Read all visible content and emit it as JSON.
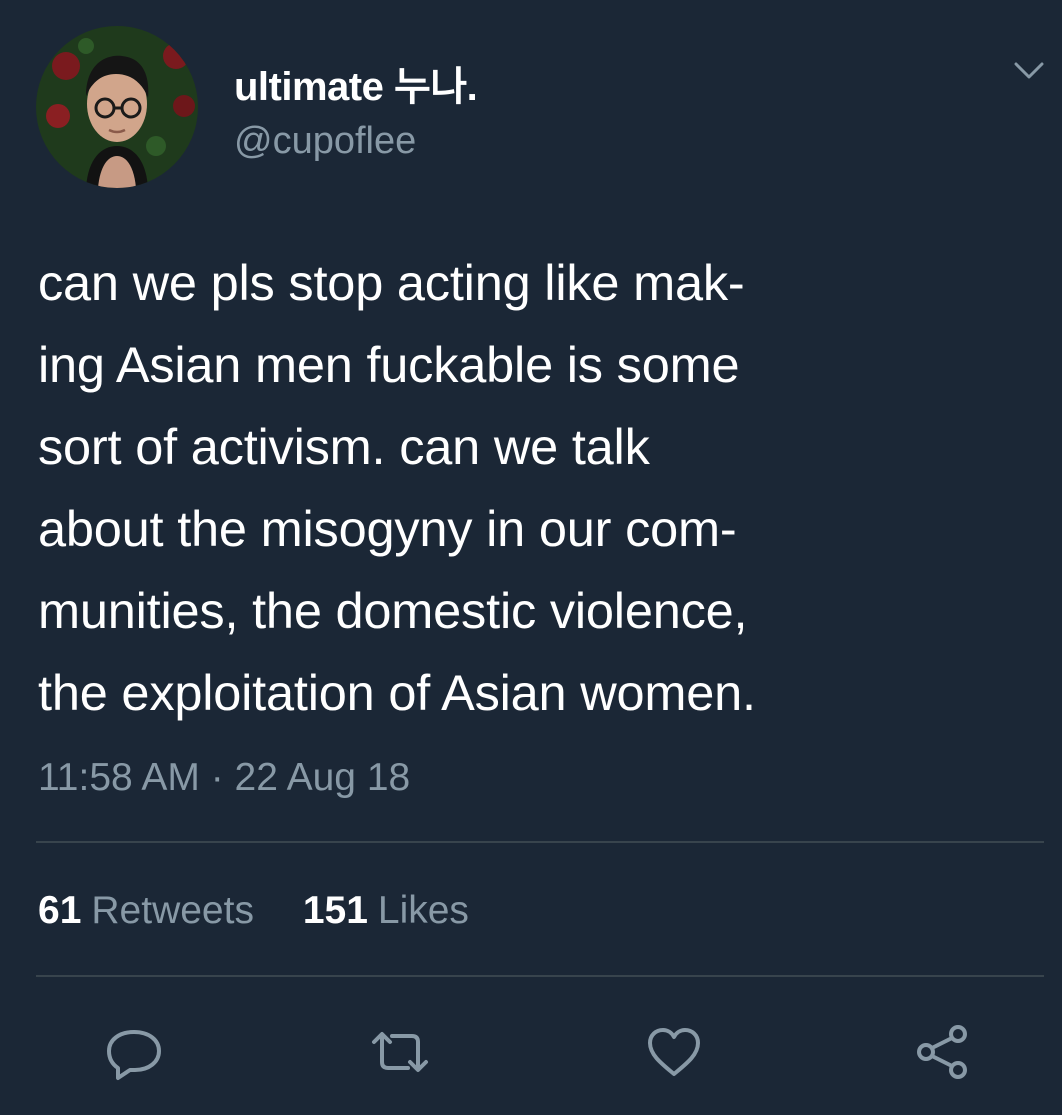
{
  "user": {
    "display_name": "ultimate 누나.",
    "handle": "@cupoflee"
  },
  "tweet": {
    "lines": [
      "can we pls stop acting like mak-",
      "ing Asian men fuckable is some",
      "sort of activism. can we talk",
      "about the misogyny in our com-",
      "munities, the domestic violence,",
      "the exploitation of Asian women."
    ],
    "timestamp": "11:58 AM · 22 Aug 18"
  },
  "stats": {
    "retweets_count": "61",
    "retweets_label": "Retweets",
    "likes_count": "151",
    "likes_label": "Likes"
  },
  "icons": {
    "menu": "chevron-down-icon",
    "reply": "reply-icon",
    "retweet": "retweet-icon",
    "like": "heart-icon",
    "share": "share-icon"
  },
  "colors": {
    "background": "#1b2736",
    "primary_text": "#ffffff",
    "secondary_text": "#8899a6",
    "divider": "#38444d"
  }
}
